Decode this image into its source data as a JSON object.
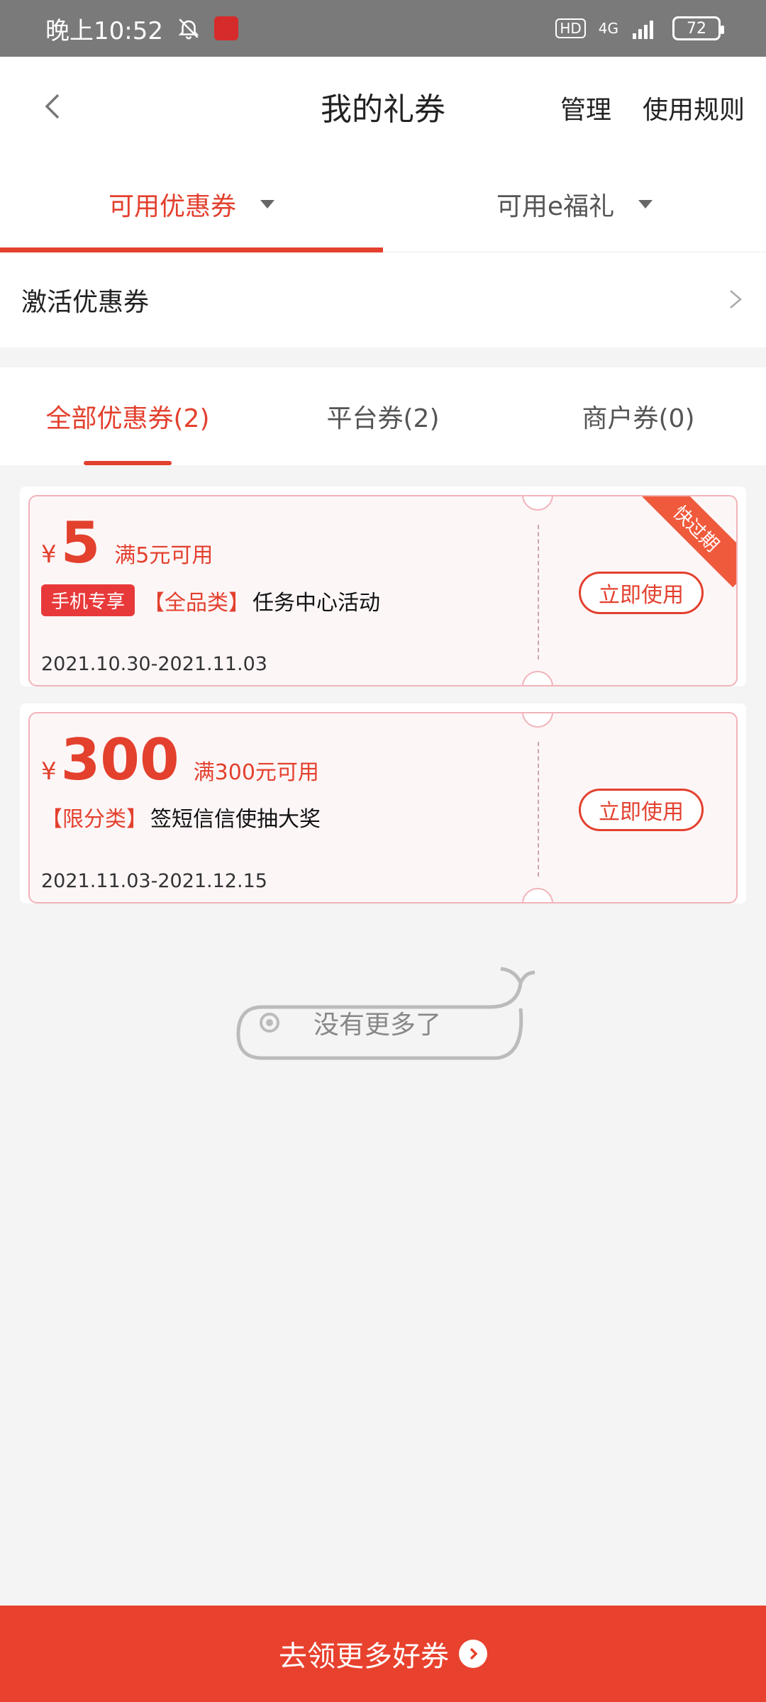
{
  "status_bar": {
    "time": "晚上10:52",
    "hd": "HD",
    "network": "4G",
    "battery": "72"
  },
  "header": {
    "title": "我的礼券",
    "manage_label": "管理",
    "rules_label": "使用规则"
  },
  "top_tabs": [
    {
      "label": "可用优惠券",
      "active": true
    },
    {
      "label": "可用e福礼",
      "active": false
    }
  ],
  "activate_row": {
    "label": "激活优惠券"
  },
  "sub_tabs": [
    {
      "label": "全部优惠券(2)",
      "active": true
    },
    {
      "label": "平台券(2)",
      "active": false
    },
    {
      "label": "商户券(0)",
      "active": false
    }
  ],
  "coupons": [
    {
      "currency": "¥",
      "amount": "5",
      "condition": "满5元可用",
      "tag": "手机专享",
      "category": "【全品类】",
      "title": "任务中心活动",
      "date_range": "2021.10.30-2021.11.03",
      "button_label": "立即使用",
      "ribbon": "快过期"
    },
    {
      "currency": "¥",
      "amount": "300",
      "condition": "满300元可用",
      "tag": "",
      "category": "【限分类】",
      "title": "签短信信使抽大奖",
      "date_range": "2021.11.03-2021.12.15",
      "button_label": "立即使用",
      "ribbon": ""
    }
  ],
  "no_more": "没有更多了",
  "bottom_bar": {
    "label": "去领更多好券"
  },
  "colors": {
    "accent": "#e3402e",
    "bottom": "#e8412d",
    "background": "#f4f4f4"
  }
}
